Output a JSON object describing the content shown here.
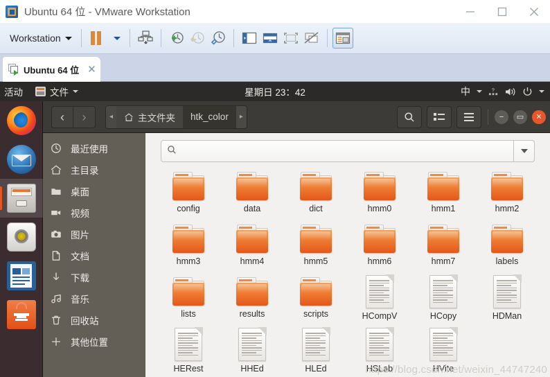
{
  "window": {
    "title": "Ubuntu 64 位 - VMware Workstation",
    "minimize": "—",
    "maximize": "□",
    "close": "✕"
  },
  "toolbar": {
    "menu_label": "Workstation",
    "icons": [
      "pause-icon",
      "dropdown-caret-icon",
      "snapshot-manager-icon",
      "take-snapshot-icon",
      "revert-snapshot-icon",
      "manage-snapshots-icon",
      "show-sidebar-icon",
      "console-view-icon",
      "full-screen-icon",
      "multi-monitor-icon",
      "library-panel-icon"
    ]
  },
  "tab": {
    "label": "Ubuntu 64 位",
    "close": "✕"
  },
  "gnome_panel": {
    "activities": "活动",
    "app_name": "文件",
    "clock": "星期日 23：42",
    "ime": "中",
    "right_icons": [
      "accessibility-icon",
      "volume-icon",
      "power-icon",
      "chevron-down-icon"
    ]
  },
  "dock": {
    "items": [
      {
        "name": "firefox",
        "active": false
      },
      {
        "name": "thunderbird",
        "active": false
      },
      {
        "name": "files",
        "active": true
      },
      {
        "name": "rhythmbox",
        "active": false
      },
      {
        "name": "libreoffice-writer",
        "active": false
      },
      {
        "name": "ubuntu-software",
        "active": false
      }
    ]
  },
  "nautilus": {
    "nav": {
      "back": "‹",
      "forward": "›"
    },
    "breadcrumb": {
      "left_arrow": "◂",
      "right_arrow": "▸",
      "items": [
        {
          "label": "主文件夹",
          "icon": "home-icon",
          "active": false
        },
        {
          "label": "htk_color",
          "icon": "",
          "active": true
        }
      ]
    },
    "header_buttons": [
      "search-icon",
      "list-view-icon",
      "hamburger-menu-icon"
    ],
    "window_controls": {
      "minimize": "−",
      "maximize": "▭",
      "close": "✕"
    },
    "search": {
      "value": "",
      "placeholder": ""
    },
    "sidebar": [
      {
        "label": "最近使用",
        "icon": "clock-icon"
      },
      {
        "label": "主目录",
        "icon": "home-icon"
      },
      {
        "label": "桌面",
        "icon": "desktop-folder-icon"
      },
      {
        "label": "视频",
        "icon": "video-icon"
      },
      {
        "label": "图片",
        "icon": "camera-icon"
      },
      {
        "label": "文档",
        "icon": "document-icon"
      },
      {
        "label": "下载",
        "icon": "download-icon"
      },
      {
        "label": "音乐",
        "icon": "music-icon"
      },
      {
        "label": "回收站",
        "icon": "trash-icon"
      },
      {
        "label": "其他位置",
        "icon": "plus-icon"
      }
    ],
    "files": [
      {
        "name": "config",
        "type": "folder"
      },
      {
        "name": "data",
        "type": "folder"
      },
      {
        "name": "dict",
        "type": "folder"
      },
      {
        "name": "hmm0",
        "type": "folder"
      },
      {
        "name": "hmm1",
        "type": "folder"
      },
      {
        "name": "hmm2",
        "type": "folder"
      },
      {
        "name": "hmm3",
        "type": "folder"
      },
      {
        "name": "hmm4",
        "type": "folder"
      },
      {
        "name": "hmm5",
        "type": "folder"
      },
      {
        "name": "hmm6",
        "type": "folder"
      },
      {
        "name": "hmm7",
        "type": "folder"
      },
      {
        "name": "labels",
        "type": "folder"
      },
      {
        "name": "lists",
        "type": "folder"
      },
      {
        "name": "results",
        "type": "folder"
      },
      {
        "name": "scripts",
        "type": "folder"
      },
      {
        "name": "HCompV",
        "type": "document"
      },
      {
        "name": "HCopy",
        "type": "document"
      },
      {
        "name": "HDMan",
        "type": "document"
      },
      {
        "name": "HERest",
        "type": "document"
      },
      {
        "name": "HHEd",
        "type": "document"
      },
      {
        "name": "HLEd",
        "type": "document"
      },
      {
        "name": "HSLab",
        "type": "document"
      },
      {
        "name": "HVite",
        "type": "document"
      }
    ]
  },
  "watermark": "https://blog.csdn.net/weixin_44747240",
  "colors": {
    "ubuntu_orange": "#e95420",
    "folder_orange": "#ee7b32",
    "panel_dark": "#2b2a28",
    "sidebar_gray": "#635f57",
    "vmware_blue": "#ccd5e8"
  }
}
